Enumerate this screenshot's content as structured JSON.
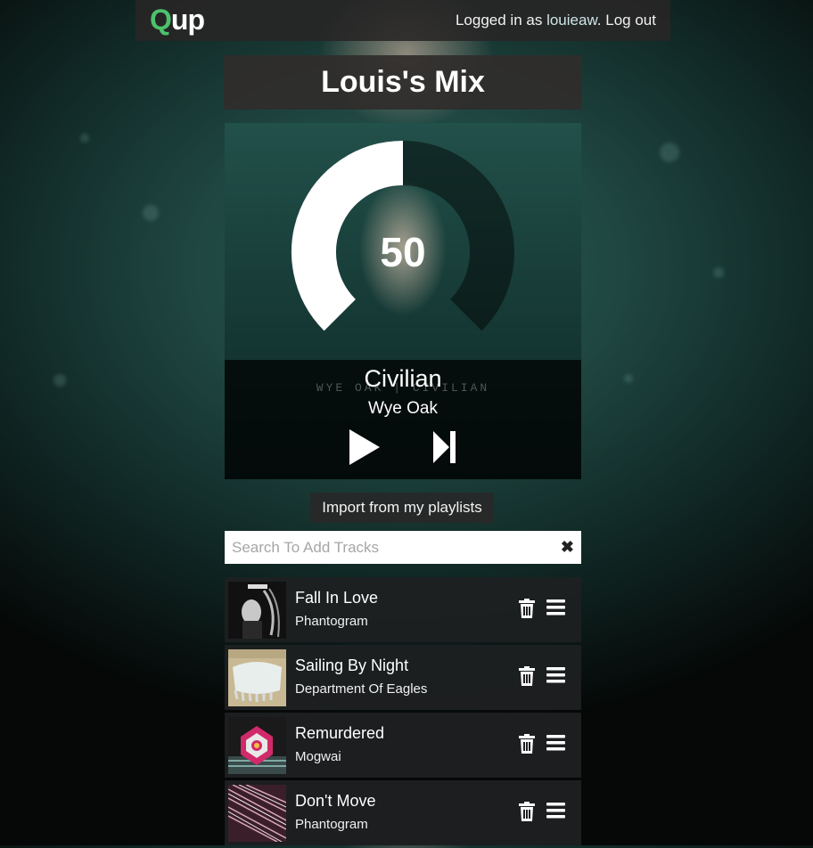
{
  "header": {
    "logo_q": "Q",
    "logo_rest": "up",
    "login_prefix": "Logged in as",
    "username": "louieaw",
    "logout_label": "Log out"
  },
  "playlist": {
    "title": "Louis's Mix"
  },
  "player": {
    "volume": 50,
    "volume_text": "50",
    "volume_fraction": 0.5,
    "now_playing_title": "Civilian",
    "now_playing_artist": "Wye Oak",
    "album_art_text": "WYE OAK | CIVILIAN",
    "play_icon": "play-icon",
    "next_icon": "skip-next-icon"
  },
  "import_label": "Import from my playlists",
  "search": {
    "placeholder": "Search To Add Tracks",
    "value": "",
    "clear_icon": "close-icon"
  },
  "tracks": [
    {
      "title": "Fall In Love",
      "artist": "Phantogram"
    },
    {
      "title": "Sailing By Night",
      "artist": "Department Of Eagles"
    },
    {
      "title": "Remurdered",
      "artist": "Mogwai"
    },
    {
      "title": "Don't Move",
      "artist": "Phantogram"
    }
  ],
  "colors": {
    "brand_green": "#4cc26c",
    "bar_bg": "#282626"
  }
}
